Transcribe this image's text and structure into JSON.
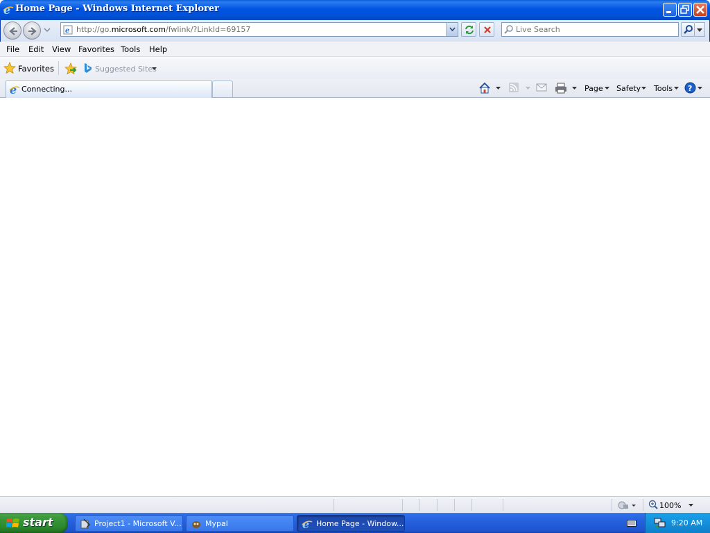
{
  "window": {
    "title": "Home Page - Windows Internet Explorer"
  },
  "address_bar": {
    "url_prefix": "http://go.",
    "url_domain": "microsoft.com",
    "url_suffix": "/fwlink/?LinkId=69157"
  },
  "search": {
    "placeholder": "Live Search"
  },
  "menu": {
    "items": [
      "File",
      "Edit",
      "View",
      "Favorites",
      "Tools",
      "Help"
    ]
  },
  "favorites_bar": {
    "favorites_label": "Favorites",
    "suggested_label": "Suggested Sites"
  },
  "tabs": [
    {
      "label": "Connecting..."
    }
  ],
  "command_bar": {
    "page_label": "Page",
    "safety_label": "Safety",
    "tools_label": "Tools"
  },
  "status_bar": {
    "zoom": "100%"
  },
  "taskbar": {
    "start_label": "start",
    "tasks": [
      {
        "label": "Project1 - Microsoft V..."
      },
      {
        "label": "Mypal"
      },
      {
        "label": "Home Page - Window..."
      }
    ],
    "clock": "9:20 AM"
  },
  "colors": {
    "titlebar_blue": "#0054e3",
    "start_green": "#3d9a3d",
    "tray_blue": "#1490dc"
  }
}
